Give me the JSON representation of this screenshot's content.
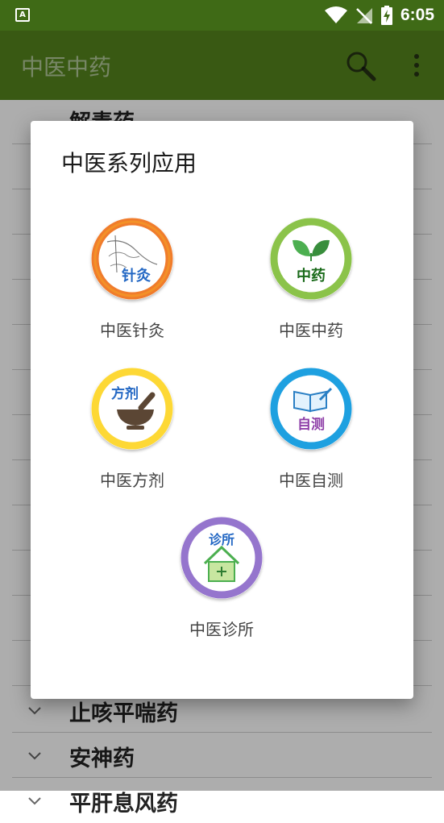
{
  "status_bar": {
    "time": "6:05",
    "left_icon_letter": "A"
  },
  "app_bar": {
    "title": "中医中药"
  },
  "list": {
    "items": [
      {
        "label": "解毒药"
      },
      {
        "label": "止咳平喘药"
      },
      {
        "label": "安神药"
      },
      {
        "label": "平肝息风药"
      }
    ]
  },
  "dialog": {
    "title": "中医系列应用",
    "apps": [
      {
        "label": "中医针灸",
        "icon_text": "针灸",
        "ring_color": "#f07c2c",
        "icon": "acupuncture-icon"
      },
      {
        "label": "中医中药",
        "icon_text": "中药",
        "ring_color": "#8bc34a",
        "icon": "herb-icon"
      },
      {
        "label": "中医方剂",
        "icon_text": "方剂",
        "ring_color": "#fdd835",
        "icon": "mortar-icon"
      },
      {
        "label": "中医自测",
        "icon_text": "自测",
        "ring_color": "#1ea0e0",
        "icon": "book-icon"
      },
      {
        "label": "中医诊所",
        "icon_text": "诊所",
        "ring_color": "#9575cd",
        "icon": "clinic-icon"
      }
    ]
  },
  "colors": {
    "status_bar": "#3f6a16",
    "app_bar": "#55831d"
  }
}
